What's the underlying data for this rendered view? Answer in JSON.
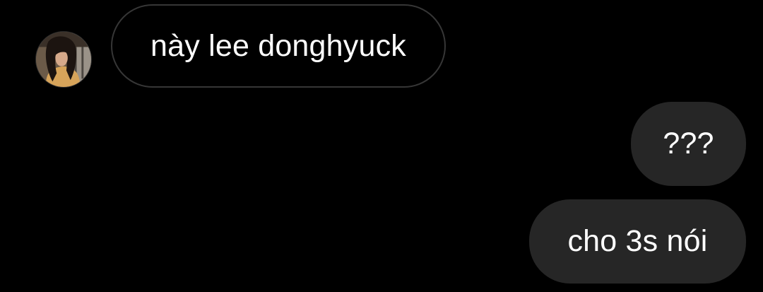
{
  "conversation": {
    "messages": [
      {
        "sender": "other",
        "text": "này lee donghyuck"
      },
      {
        "sender": "me",
        "text": "???"
      },
      {
        "sender": "me",
        "text": "cho 3s nói"
      }
    ]
  },
  "colors": {
    "background": "#000000",
    "incoming_bubble_border": "#363636",
    "outgoing_bubble": "#262626",
    "text": "#ffffff"
  },
  "icons": {
    "avatar": "sender-avatar-photo"
  }
}
